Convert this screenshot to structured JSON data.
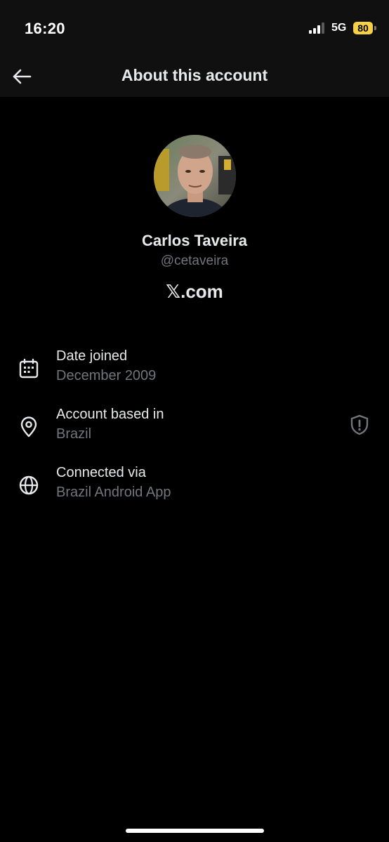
{
  "status_bar": {
    "time": "16:20",
    "network": "5G",
    "battery": "80"
  },
  "header": {
    "title": "About this account"
  },
  "profile": {
    "name": "Carlos Taveira",
    "handle": "@cetaveira",
    "site": "𝕏.com"
  },
  "details": [
    {
      "icon": "calendar-icon",
      "title": "Date joined",
      "value": "December 2009"
    },
    {
      "icon": "location-pin-icon",
      "title": "Account based in",
      "value": "Brazil"
    },
    {
      "icon": "globe-icon",
      "title": "Connected via",
      "value": "Brazil Android App"
    }
  ],
  "colors": {
    "background": "#000000",
    "header_bg": "#101010",
    "primary_text": "#e7e9ea",
    "secondary_text": "#71767b",
    "battery": "#f7d046"
  }
}
